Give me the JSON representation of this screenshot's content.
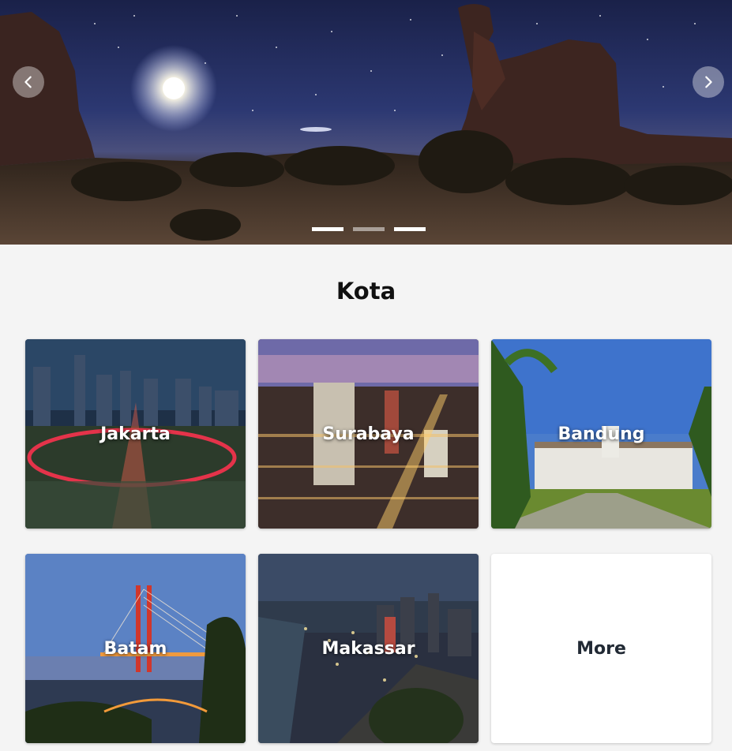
{
  "carousel": {
    "prev_icon": "chevron-left-icon",
    "next_icon": "chevron-right-icon",
    "slide_count": 3,
    "active_slide": 1
  },
  "section": {
    "title": "Kota"
  },
  "cities": [
    {
      "name": "Jakarta"
    },
    {
      "name": "Surabaya"
    },
    {
      "name": "Bandung"
    },
    {
      "name": "Batam"
    },
    {
      "name": "Makassar"
    }
  ],
  "more_label": "More"
}
